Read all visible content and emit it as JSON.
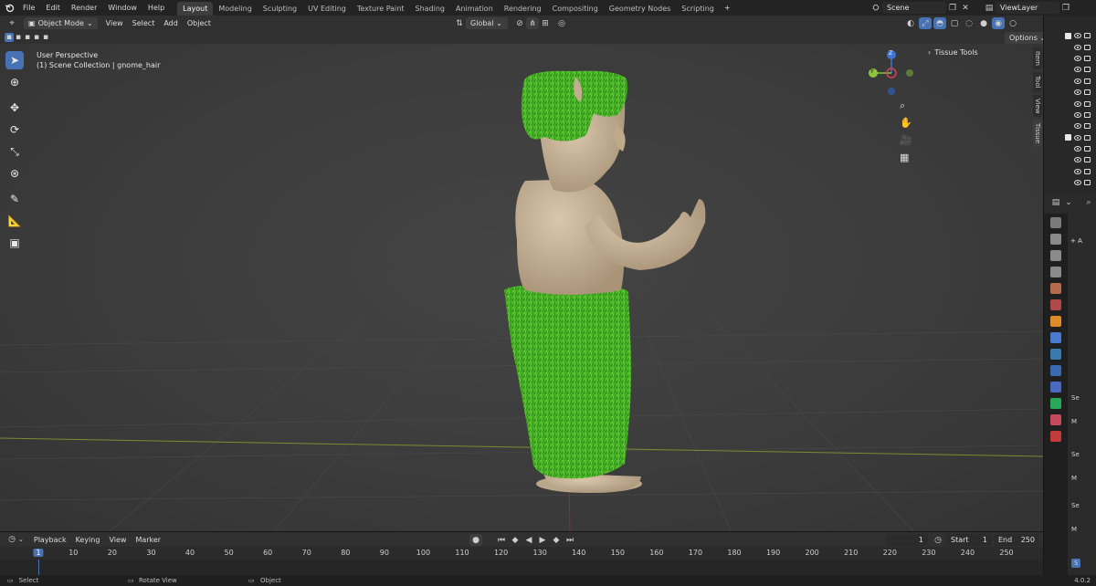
{
  "menu": [
    "File",
    "Edit",
    "Render",
    "Window",
    "Help"
  ],
  "workspaces": [
    {
      "label": "Layout",
      "active": true
    },
    {
      "label": "Modeling"
    },
    {
      "label": "Sculpting"
    },
    {
      "label": "UV Editing"
    },
    {
      "label": "Texture Paint"
    },
    {
      "label": "Shading"
    },
    {
      "label": "Animation"
    },
    {
      "label": "Rendering"
    },
    {
      "label": "Compositing"
    },
    {
      "label": "Geometry Nodes"
    },
    {
      "label": "Scripting"
    }
  ],
  "add_workspace": "+",
  "scene": "Scene",
  "view_layer": "ViewLayer",
  "viewport": {
    "mode": "Object Mode",
    "menus": [
      "View",
      "Select",
      "Add",
      "Object"
    ],
    "orientation": "Global",
    "options": "Options",
    "perspective": "User Perspective",
    "collection": "(1) Scene Collection | gnome_hair",
    "sidebar_title": "Tissue Tools",
    "side_tabs": [
      "Item",
      "Tool",
      "View",
      "Tissue"
    ],
    "gizmo": {
      "z": "Z",
      "y": "Y"
    }
  },
  "timeline": {
    "menus": [
      "Playback",
      "Keying",
      "View",
      "Marker"
    ],
    "current_frame": "1",
    "start_label": "Start",
    "start": "1",
    "end_label": "End",
    "end": "250",
    "ticks": [
      "1",
      "10",
      "20",
      "30",
      "40",
      "50",
      "60",
      "70",
      "80",
      "90",
      "100",
      "110",
      "120",
      "130",
      "140",
      "150",
      "160",
      "170",
      "180",
      "190",
      "200",
      "210",
      "220",
      "230",
      "240",
      "250"
    ]
  },
  "properties": {
    "add_label": "+ A",
    "panel_labels": [
      "Se",
      "M",
      "Se",
      "M",
      "Se",
      "M",
      "S"
    ]
  },
  "status": {
    "select": "Select",
    "rotate": "Rotate View",
    "object": "Object",
    "version": "4.0.2"
  },
  "colors": {
    "accent": "#4772b3",
    "hair_green": "#4fbf2a",
    "skin": "#c8b49a",
    "x_axis": "#d9434f",
    "y_axis": "#8bc43e",
    "z_axis": "#3f74d6"
  }
}
